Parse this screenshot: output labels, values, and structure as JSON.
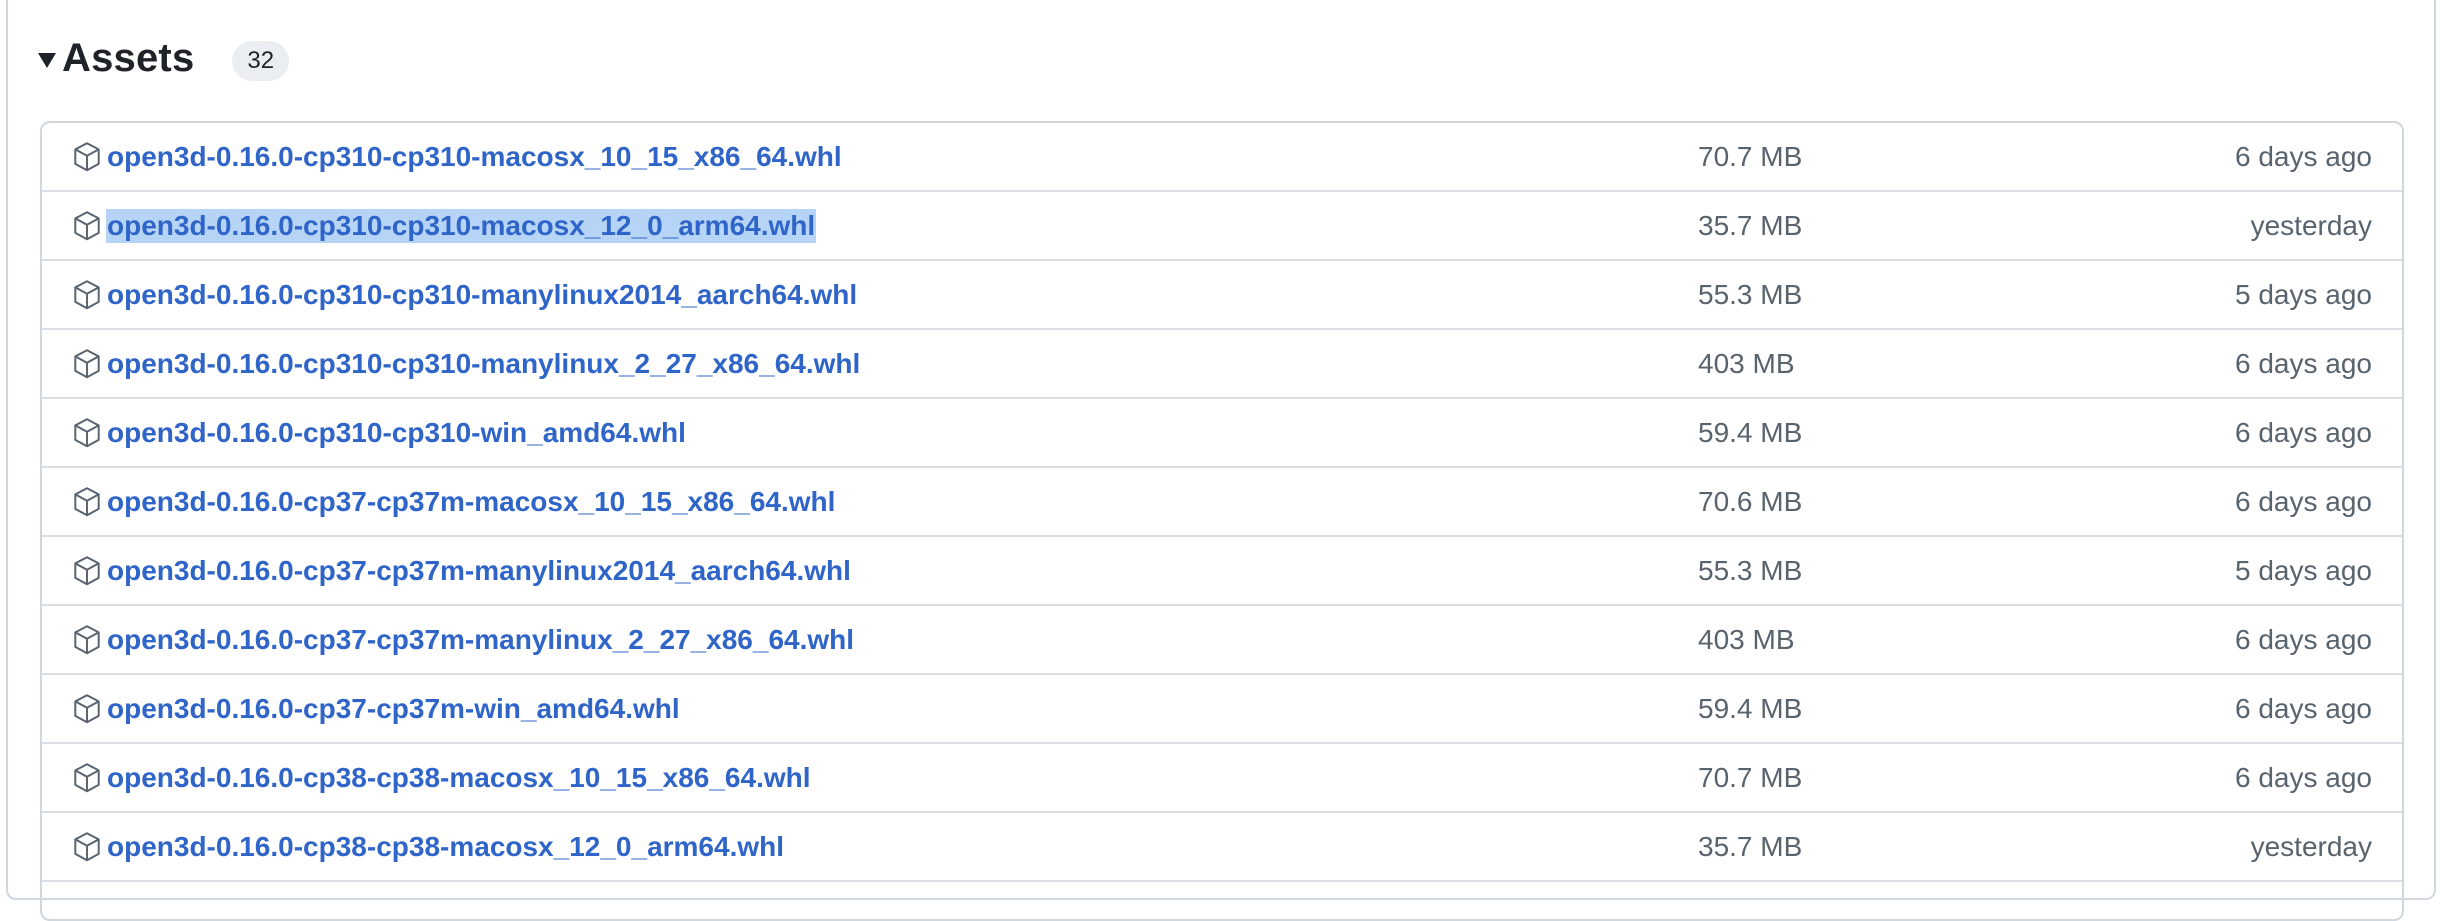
{
  "assets": {
    "title": "Assets",
    "count": "32",
    "colors": {
      "link": "#2f64c8",
      "muted": "#59636e",
      "selection": "#b6d4f5",
      "border": "#d0d7de"
    },
    "icon": "package-icon",
    "items": [
      {
        "name": "open3d-0.16.0-cp310-cp310-macosx_10_15_x86_64.whl",
        "size": "70.7 MB",
        "date": "6 days ago",
        "selected": false
      },
      {
        "name": "open3d-0.16.0-cp310-cp310-macosx_12_0_arm64.whl",
        "size": "35.7 MB",
        "date": "yesterday",
        "selected": true
      },
      {
        "name": "open3d-0.16.0-cp310-cp310-manylinux2014_aarch64.whl",
        "size": "55.3 MB",
        "date": "5 days ago",
        "selected": false
      },
      {
        "name": "open3d-0.16.0-cp310-cp310-manylinux_2_27_x86_64.whl",
        "size": "403 MB",
        "date": "6 days ago",
        "selected": false
      },
      {
        "name": "open3d-0.16.0-cp310-cp310-win_amd64.whl",
        "size": "59.4 MB",
        "date": "6 days ago",
        "selected": false
      },
      {
        "name": "open3d-0.16.0-cp37-cp37m-macosx_10_15_x86_64.whl",
        "size": "70.6 MB",
        "date": "6 days ago",
        "selected": false
      },
      {
        "name": "open3d-0.16.0-cp37-cp37m-manylinux2014_aarch64.whl",
        "size": "55.3 MB",
        "date": "5 days ago",
        "selected": false
      },
      {
        "name": "open3d-0.16.0-cp37-cp37m-manylinux_2_27_x86_64.whl",
        "size": "403 MB",
        "date": "6 days ago",
        "selected": false
      },
      {
        "name": "open3d-0.16.0-cp37-cp37m-win_amd64.whl",
        "size": "59.4 MB",
        "date": "6 days ago",
        "selected": false
      },
      {
        "name": "open3d-0.16.0-cp38-cp38-macosx_10_15_x86_64.whl",
        "size": "70.7 MB",
        "date": "6 days ago",
        "selected": false
      },
      {
        "name": "open3d-0.16.0-cp38-cp38-macosx_12_0_arm64.whl",
        "size": "35.7 MB",
        "date": "yesterday",
        "selected": false
      }
    ]
  }
}
